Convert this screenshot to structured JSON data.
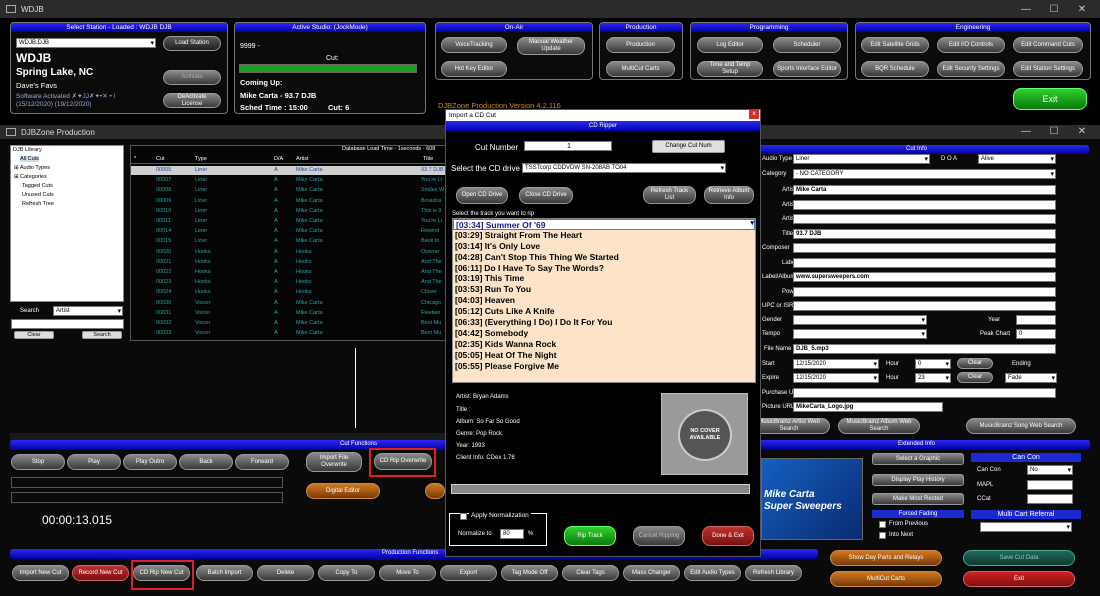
{
  "app": {
    "title": "WDJB"
  },
  "station": {
    "header": "Select Station - Loaded : WDJB DJB",
    "select_value": "WDJB.DJB",
    "load_label": "Load Station",
    "call": "WDJB",
    "city": "Spring Lake, NC",
    "slogan": "Dave's Favs",
    "activate_label": "Activate",
    "activated_text": "Software Activated ✗✦JJ✗✦•✕ • l",
    "dates": "(15/12/2020) (19/12/2020)",
    "deactivate_label": "DeActivate License"
  },
  "studio": {
    "header": "Active Studio:   (JockMode)",
    "cut_id": "9999 -",
    "cut_label": "Cut:",
    "coming_up": "Coming Up:",
    "artist_title": "Mike Carta - 93.7 DJB",
    "sched_time": "Sched Time : 15:00",
    "cut_num": "Cut: 6"
  },
  "onair": {
    "header": "On-Air",
    "buttons": [
      "VoiceTracking",
      "Manual Weather Update",
      "Hot Key Editor"
    ]
  },
  "production": {
    "header": "Production",
    "buttons": [
      "Production",
      "MultiCut Carts"
    ]
  },
  "programming": {
    "header": "Programming",
    "buttons": [
      "Log Editor",
      "Scheduler",
      "Time and Temp Setup",
      "Sports Interface Editor"
    ]
  },
  "engineering": {
    "header": "Engineering",
    "buttons": [
      "Edit Satellite Grids",
      "Edit I/O Controls",
      "Edit Command Cuts",
      "BQR Schedule",
      "Edit Security Settings",
      "Edit Station Settings"
    ]
  },
  "exit_label": "Exit",
  "version": "DJBZone Production Version 4.2.116",
  "prod_window": {
    "title": "DJBZone Production"
  },
  "library": {
    "tree": [
      "DJB Library",
      "All Cuts",
      "Audio Types",
      "Categories",
      "Tagged Cuts",
      "Unused Cuts",
      "Refresh Tree"
    ],
    "search_label": "Search",
    "search_field": "Artist",
    "clear": "Clear",
    "search": "Search"
  },
  "grid": {
    "load_time": "Database Load Time - 1seconds - 608",
    "headers": [
      "*",
      "Cut",
      "Type",
      "D/A",
      "Artist",
      "Title"
    ],
    "rows": [
      [
        "",
        "00005",
        "Liner",
        "A",
        "Mike Carta",
        "93.7 DJB"
      ],
      [
        "",
        "00007",
        "Liner",
        "A",
        "Mike Carta",
        "You're Li"
      ],
      [
        "",
        "00008",
        "Liner",
        "A",
        "Mike Carta",
        "Smiles W"
      ],
      [
        "",
        "00009",
        "Liner",
        "A",
        "Mike Carta",
        "Broadca"
      ],
      [
        "",
        "00010",
        "Liner",
        "A",
        "Mike Carta",
        "This is 9"
      ],
      [
        "",
        "00011",
        "Liner",
        "A",
        "Mike Carta",
        "You're Li"
      ],
      [
        "",
        "00014",
        "Liner",
        "A",
        "Mike Carta",
        "Rewind"
      ],
      [
        "",
        "00015",
        "Liner",
        "A",
        "Mike Carta",
        "Back to"
      ],
      [
        "",
        "00020",
        "Hooks",
        "A",
        "Hooks",
        "Opener"
      ],
      [
        "",
        "00021",
        "Hooks",
        "A",
        "Hooks",
        "And The"
      ],
      [
        "",
        "00022",
        "Hooks",
        "A",
        "Hooks",
        "And The"
      ],
      [
        "",
        "00023",
        "Hooks",
        "A",
        "Hooks",
        "And The"
      ],
      [
        "",
        "00024",
        "Hooks",
        "A",
        "Hooks",
        "Closer"
      ],
      [
        "",
        "00030",
        "Voicer",
        "A",
        "Mike Carta",
        "Chicago"
      ],
      [
        "",
        "00031",
        "Voicer",
        "A",
        "Mike Carta",
        "Fleetwo"
      ],
      [
        "",
        "00032",
        "Voicer",
        "A",
        "Mike Carta",
        "Best Mu"
      ],
      [
        "",
        "00033",
        "Voicer",
        "A",
        "Mike Carta",
        "Best Mu"
      ]
    ]
  },
  "cut_functions": {
    "header": "Cut Functions",
    "buttons": [
      "Stop",
      "Play",
      "Play Outro",
      "Back",
      "Forward"
    ],
    "import_overwrite": "Import File Overwrite",
    "cd_rip_overwrite": "CD Rip Overwrite",
    "digital_editor": "Digital Editor",
    "timer": "00:00:13.015"
  },
  "prod_functions": {
    "header": "Production Functions",
    "buttons": [
      "Import New Cut",
      "Record New Cut",
      "CD Rip New Cut",
      "Batch Import",
      "Delete",
      "Copy To",
      "Move To",
      "Export",
      "Tag Mode Off",
      "Clear Tags",
      "Mass Changer",
      "Edit Audio Types",
      "Refresh Library"
    ]
  },
  "dialog": {
    "title": "Import a CD Cut",
    "close": "x",
    "header": "CD Ripper",
    "cut_number_label": "Cut Number",
    "cut_number": "1",
    "change_cut": "Change Cut Num",
    "drive_label": "Select the CD drive",
    "drive": "TSSTcorp CDDVDW SN-208AB TO04",
    "open_cd": "Open CD Drive",
    "close_cd": "Close CD Drive",
    "refresh": "Refresh Track List",
    "retrieve": "Retrieve Album Info",
    "select_track": "Select the track you want to rip",
    "tracks": [
      "[03:34] Summer Of '69",
      "[03:29] Straight From The Heart",
      "[03:14] It's Only Love",
      "[04:28] Can't Stop This Thing We Started",
      "[06:11] Do I Have To Say The Words?",
      "[03:19] This Time",
      "[03:53] Run To You",
      "[04:03] Heaven",
      "[05:12] Cuts Like A Knife",
      "[06:33] (Everything I Do) I Do It For You",
      "[04:42] Somebody",
      "[02:35] Kids Wanna Rock",
      "[05:05] Heat Of The Night",
      "[05:55] Please Forgive Me"
    ],
    "artist": "Artist: Bryan Adams",
    "title_line": "Title :",
    "album": "Album: So Far So Good",
    "genre": "Genre: Pop Rock",
    "year": "Year: 1993",
    "client": "Client Info: CDex 1.78",
    "no_cover": "NO COVER AVAILABLE",
    "normalization": "Apply Normalization",
    "normalize_to": "Normalize to",
    "normalize_value": "80",
    "percent": "%",
    "rip": "Rip Track",
    "cancel": "Cancel Ripping",
    "done": "Done & Exit"
  },
  "cut_info": {
    "header": "Cut Info",
    "audio_type_label": "Audio Type",
    "audio_type": "Liner",
    "doa_label": "D O A",
    "doa": "Alive",
    "category_label": "Category",
    "category": "- NO CATEGORY",
    "artist_label": "Artist",
    "artist": "Mike Carta",
    "artist2_label": "Artist 2",
    "artist3_label": "Artist 3",
    "title_label": "Title",
    "title": "93.7 DJB",
    "composer_label": "Composer",
    "label_label": "Label",
    "album_label": "Label/Album",
    "album": "www.supersweepers.com",
    "power_label": "Power",
    "isrc_label": "UPC or ISRC",
    "gender_label": "Gender",
    "year_label": "Year",
    "tempo_label": "Tempo",
    "peak_label": "Peak Chart",
    "peak": "0",
    "file_label": "File Name",
    "file": "DJB_5.mp3",
    "start_label": "Start",
    "start_date": "12/15/2020",
    "hour_label": "Hour",
    "start_hour": "0",
    "clear": "Clear",
    "ending_label": "Ending",
    "expire_label": "Expire",
    "expire_date": "12/15/2020",
    "expire_hour": "23",
    "ending": "Fade",
    "purchase_label": "Purchase URL",
    "picture_label": "Picture URL",
    "picture": "MikeCarta_Logo.jpg",
    "mb_artist": "MusicBrainz Artist Web Search",
    "mb_album": "MusicBrainz Album Web Search",
    "mb_song": "MusicBrainz Song Web Search"
  },
  "extended": {
    "header": "Extended Info",
    "select_graphic": "Select a Graphic",
    "play_history": "Display Play History",
    "most_rested": "Make Most Rested",
    "forced_fading": "Forced Fading",
    "from_previous": "From Previous",
    "into_next": "Into Next",
    "can_con_header": "Can Con",
    "can_con_label": "Can Con",
    "can_con": "No",
    "mapl": "MAPL",
    "ccat": "CCat",
    "multi_cart": "Multi Cart Referral",
    "banner1": "Mike Carta",
    "banner2": "Super Sweepers"
  },
  "bottom_right": {
    "show_day": "Show Day Parts and Relays",
    "save_cut": "Save Cut Data",
    "multicut": "MultiCut Carts",
    "exit": "Exit"
  }
}
